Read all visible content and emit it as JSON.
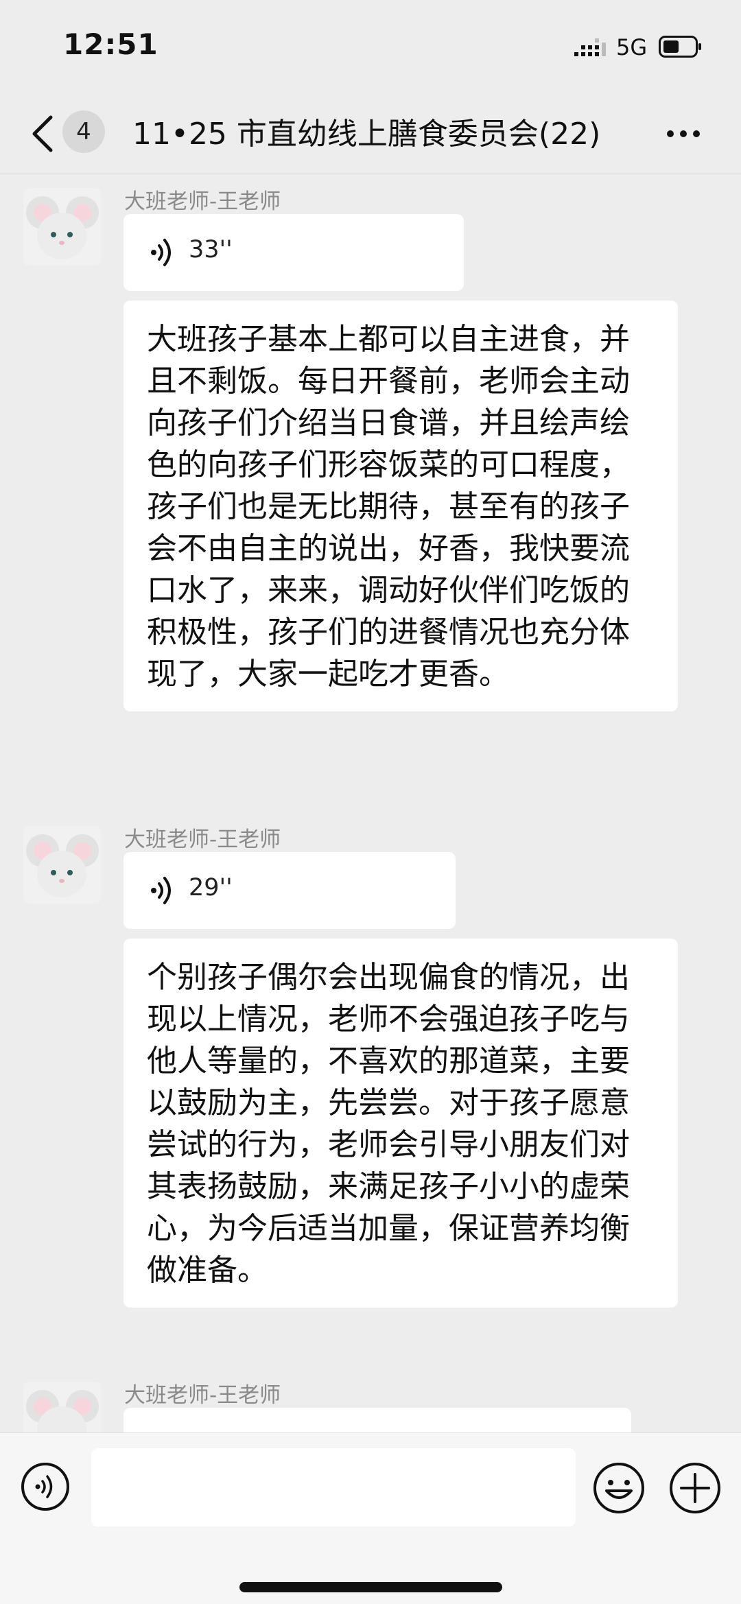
{
  "status_bar": {
    "time": "12:51",
    "network": "5G"
  },
  "nav": {
    "unread_count": "4",
    "title": "11•25 市直幼线上膳食委员会(22)"
  },
  "messages": [
    {
      "sender": "大班老师-王老师",
      "voice_duration": "33''",
      "text": "大班孩子基本上都可以自主进食，并且不剩饭。每日开餐前，老师会主动向孩子们介绍当日食谱，并且绘声绘色的向孩子们形容饭菜的可口程度，孩子们也是无比期待，甚至有的孩子会不由自主的说出，好香，我快要流口水了，来来，调动好伙伴们吃饭的积极性，孩子们的进餐情况也充分体现了，大家一起吃才更香。"
    },
    {
      "sender": "大班老师-王老师",
      "voice_duration": "29''",
      "text": "个别孩子偶尔会出现偏食的情况，出现以上情况，老师不会强迫孩子吃与他人等量的，不喜欢的那道菜，主要以鼓励为主，先尝尝。对于孩子愿意尝试的行为，老师会引导小朋友们对其表扬鼓励，来满足孩子小小的虚荣心，为今后适当加量，保证营养均衡做准备。"
    },
    {
      "sender": "大班老师-王老师"
    }
  ],
  "icons": {
    "back": "chevron-left-icon",
    "more": "more-dots-icon",
    "voice": "voice-wave-icon",
    "emoji": "smiley-icon",
    "plus": "plus-circle-icon"
  },
  "colors": {
    "background": "#ededed",
    "bubble": "#ffffff",
    "sender_text": "#8a8a8a"
  }
}
